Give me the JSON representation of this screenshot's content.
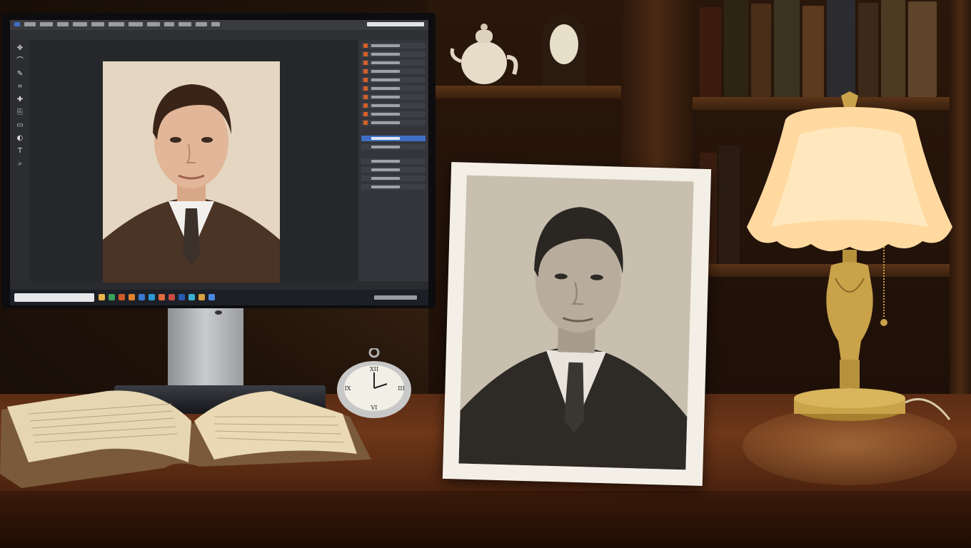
{
  "scene": {
    "description_items": [
      "monitor-with-photo-editor",
      "framed-vintage-portrait",
      "open-book",
      "pocket-watch",
      "table-lamp",
      "bookshelf"
    ]
  },
  "watch": {
    "numerals": [
      "XII",
      "III",
      "VI",
      "IX"
    ]
  },
  "colors": {
    "desk": "#6e3719",
    "lamp_shade": "#ffd9a0",
    "brass": "#c9a24a",
    "editor_selection": "#3f6fc4"
  }
}
